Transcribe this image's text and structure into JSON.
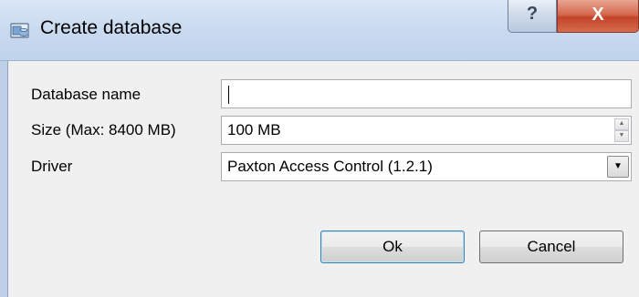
{
  "window": {
    "title": "Create database",
    "help_label": "?",
    "close_label": "X"
  },
  "form": {
    "name_label": "Database name",
    "name_value": "",
    "size_label": "Size (Max: 8400 MB)",
    "size_value": "100 MB",
    "driver_label": "Driver",
    "driver_value": "Paxton Access Control (1.2.1)"
  },
  "buttons": {
    "ok_label": "Ok",
    "cancel_label": "Cancel"
  },
  "icons": {
    "app": "database-icon",
    "spin_up": "spin-up-arrow-icon",
    "spin_down": "spin-down-arrow-icon",
    "dropdown": "chevron-down-icon"
  },
  "colors": {
    "titlebar": "#c9daf0",
    "close_button": "#c5442a",
    "dialog_background": "#f0f0f0",
    "default_button_border": "#3c7fb1"
  }
}
